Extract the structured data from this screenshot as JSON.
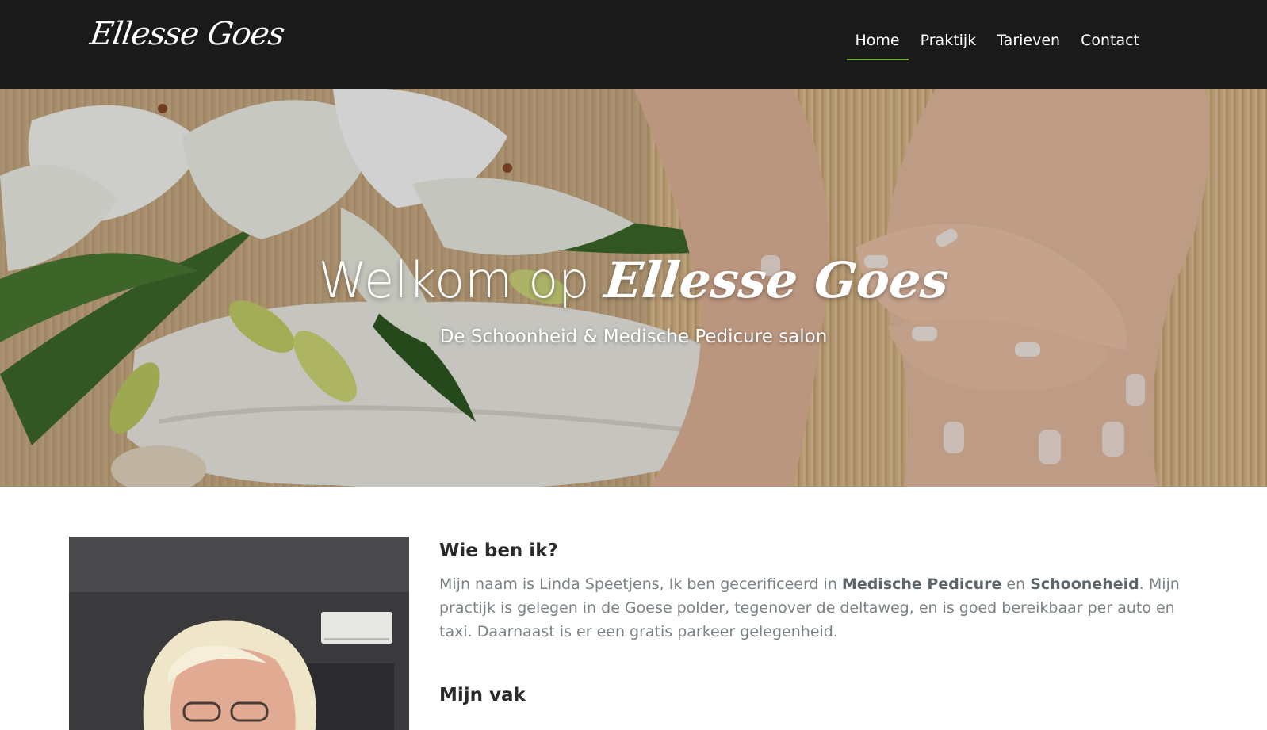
{
  "brand": {
    "name": "Ellesse Goes"
  },
  "nav": {
    "items": [
      {
        "label": "Home",
        "active": true
      },
      {
        "label": "Praktijk",
        "active": false
      },
      {
        "label": "Tarieven",
        "active": false
      },
      {
        "label": "Contact",
        "active": false
      }
    ],
    "active_color": "#6fb33a"
  },
  "hero": {
    "title_prefix": "Welkom op",
    "title_script": "Ellesse Goes",
    "subtitle": "De Schoonheid & Medische Pedicure salon"
  },
  "about": {
    "heading": "Wie ben ik?",
    "text_1": "Mijn naam is Linda Speetjens, Ik ben gecerificeerd in ",
    "bold_1": "Medische Pedicure",
    "text_2": " en ",
    "bold_2": "Schooneheid",
    "text_3": ". Mijn practijk is gelegen in de Goese polder, tegenover de deltaweg, en is goed bereikbaar per auto en taxi. Daarnaast is er een gratis parkeer gelegenheid."
  },
  "vak": {
    "heading": "Mijn vak"
  },
  "colors": {
    "navbar_bg": "#1a1a1a",
    "heading": "#2a2a2a",
    "body_text": "#7a8286"
  }
}
